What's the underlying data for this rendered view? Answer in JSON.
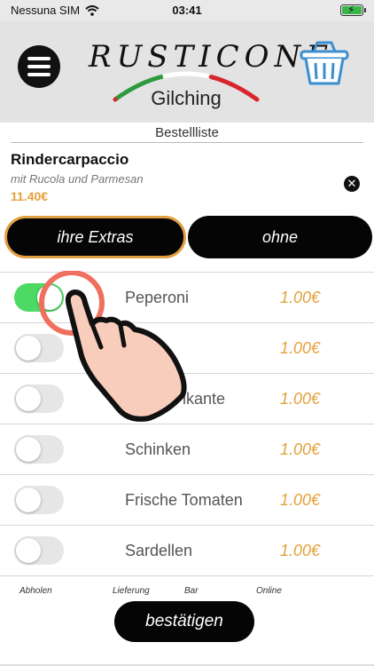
{
  "status_bar": {
    "carrier": "Nessuna SIM",
    "time": "03:41",
    "wifi_icon": "wifi-icon",
    "battery_icon": "battery-charging-icon"
  },
  "header": {
    "brand": "RUSTICONE",
    "location": "Gilching",
    "menu_icon": "hamburger-menu-icon",
    "cart_icon": "shopping-basket-icon"
  },
  "page": {
    "title": "Bestellliste"
  },
  "product": {
    "name": "Rindercarpaccio",
    "description": "mit Rucola und Parmesan",
    "price": "11.40€",
    "remove_icon": "close-circle-icon"
  },
  "options": {
    "extras_label": "ihre Extras",
    "without_label": "ohne"
  },
  "extras": [
    {
      "name": "Peperoni",
      "price": "1.00€",
      "enabled": true
    },
    {
      "name": "",
      "price": "1.00€",
      "enabled": false
    },
    {
      "name": "ikante",
      "price": "1.00€",
      "enabled": false
    },
    {
      "name": "Schinken",
      "price": "1.00€",
      "enabled": false
    },
    {
      "name": "Frische Tomaten",
      "price": "1.00€",
      "enabled": false
    },
    {
      "name": "Sardellen",
      "price": "1.00€",
      "enabled": false
    }
  ],
  "tabs": {
    "pickup": "Abholen",
    "delivery": "Lieferung",
    "bar": "Bar",
    "online": "Online"
  },
  "confirm_label": "bestätigen",
  "colors": {
    "accent": "#e5a03a",
    "toggle_on": "#4cd964",
    "button_bg": "#050505",
    "header_bg": "#e3e3e3"
  }
}
